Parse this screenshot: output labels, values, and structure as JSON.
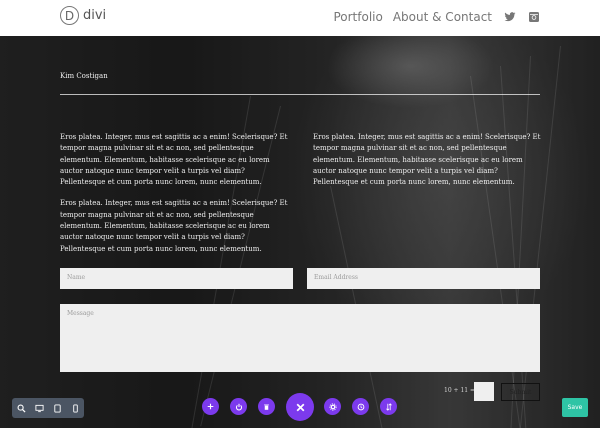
{
  "header": {
    "logo_letter": "D",
    "logo_text": "divi",
    "nav": [
      {
        "label": "Portfolio"
      },
      {
        "label": "About & Contact"
      }
    ],
    "icons": [
      "twitter-icon",
      "instagram-icon"
    ]
  },
  "main": {
    "author": "Kim Costigan",
    "left_paragraphs": [
      "Eros platea. Integer, mus est sagittis ac a enim! Scelerisque? Et tempor magna pulvinar sit et ac non, sed pellentesque elementum. Elementum, habitasse scelerisque ac eu lorem auctor natoque nunc tempor velit a turpis vel diam? Pellentesque et cum porta nunc lorem, nunc elementum.",
      "Eros platea. Integer, mus est sagittis ac a enim! Scelerisque? Et tempor magna pulvinar sit et ac non, sed pellentesque elementum. Elementum, habitasse scelerisque ac eu lorem auctor natoque nunc tempor velit a turpis vel diam? Pellentesque et cum porta nunc lorem, nunc elementum."
    ],
    "right_paragraphs": [
      "Eros platea. Integer, mus est sagittis ac a enim! Scelerisque? Et tempor magna pulvinar sit et ac non, sed pellentesque elementum. Elementum, habitasse scelerisque ac eu lorem auctor natoque nunc tempor velit a turpis vel diam? Pellentesque et cum porta nunc lorem, nunc elementum."
    ]
  },
  "form": {
    "name_placeholder": "Name",
    "email_placeholder": "Email Address",
    "message_placeholder": "Message",
    "captcha": "10 + 11 =",
    "submit_label": "Submit"
  },
  "builder": {
    "view_icons": [
      "zoom-icon",
      "desktop-icon",
      "tablet-icon",
      "phone-icon"
    ],
    "toolbar_icons": [
      "add-icon",
      "power-icon",
      "trash-icon",
      "close-icon",
      "settings-icon",
      "history-icon",
      "portability-icon"
    ],
    "save_label": "Save"
  },
  "colors": {
    "accent": "#7c3aed",
    "save": "#2ec4a5",
    "view_bar": "#4b5563"
  }
}
